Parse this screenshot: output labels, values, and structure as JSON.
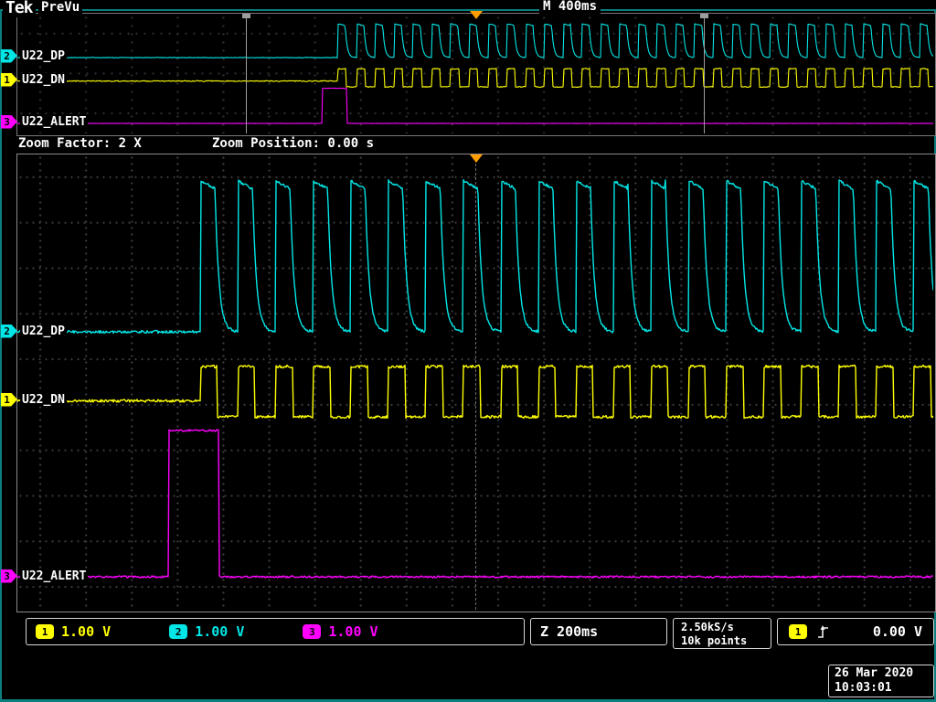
{
  "header": {
    "logo": "Tek",
    "mode": "PreVu",
    "main_timebase": "M 400ms"
  },
  "zoom_controls": {
    "factor": "Zoom Factor: 2 X",
    "position": "Zoom Position: 0.00 s"
  },
  "channels": {
    "ch1": {
      "num": "1",
      "label": "U22_DN",
      "color": "#ffff00",
      "scale": "1.00 V"
    },
    "ch2": {
      "num": "2",
      "label": "U22_DP",
      "color": "#00e6e6",
      "scale": "1.00 V"
    },
    "ch3": {
      "num": "3",
      "label": "U22_ALERT",
      "color": "#ff00ff",
      "scale": "1.00 V"
    }
  },
  "readouts": {
    "zoom_timebase": "Z 200ms",
    "sample_rate": "2.50kS/s",
    "record_length": "10k points",
    "trigger_source": "1",
    "trigger_slope": "rising-edge",
    "trigger_level": "0.00 V"
  },
  "clock": {
    "date": "26 Mar 2020",
    "time": "10:03:01"
  },
  "chart_data": {
    "type": "line",
    "title": "Oscilloscope capture: U22_DP / U22_DN / U22_ALERT",
    "x_unit": "s",
    "volts_per_div": "1.00 V",
    "windows": {
      "overview": {
        "t_start": 0,
        "t_end": 4,
        "timebase_per_div": "400ms"
      },
      "zoom": {
        "t_start": 1,
        "t_end": 3,
        "timebase_per_div": "200ms",
        "zoom_factor": 2,
        "zoom_position_s": 0
      }
    },
    "signals": [
      {
        "name": "U22_DP",
        "channel": 2,
        "color": "#00e6e6",
        "shape": "rc_pulse_train",
        "idle_v": 0.0,
        "high_v": 3.3,
        "start_s": 1.4,
        "period_s": 0.082,
        "duty": 0.38,
        "noise_v": 0.03
      },
      {
        "name": "U22_DN",
        "channel": 1,
        "color": "#ffff00",
        "shape": "square_train",
        "idle_v": 0.35,
        "high_v": 1.1,
        "low_v": 0.0,
        "start_s": 1.4,
        "period_s": 0.082,
        "duty": 0.45,
        "noise_v": 0.03
      },
      {
        "name": "U22_ALERT",
        "channel": 3,
        "color": "#ff00ff",
        "shape": "single_pulse",
        "idle_v": 0.0,
        "high_v": 3.2,
        "pulse_start_s": 1.33,
        "pulse_end_s": 1.44,
        "noise_v": 0.02
      }
    ]
  }
}
